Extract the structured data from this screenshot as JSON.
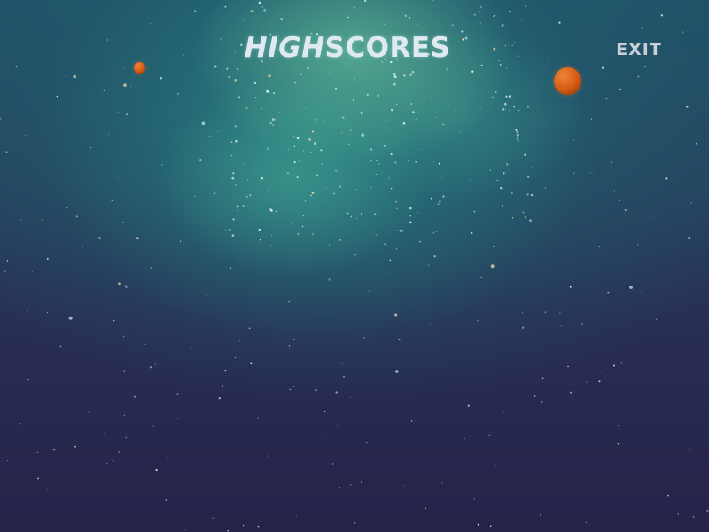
{
  "title": {
    "part1": "HIGH",
    "part2": "SCORES"
  },
  "exit_label": "EXIT",
  "planets": [
    {
      "name": "planet-small",
      "color": "#d35a12"
    },
    {
      "name": "planet-large",
      "color": "#d35a12"
    }
  ],
  "colors": {
    "background_bottom": "#26234a",
    "nebula": "#2a8a85",
    "title_text": "#dfeaf0",
    "exit_text": "#c9cfd6"
  }
}
